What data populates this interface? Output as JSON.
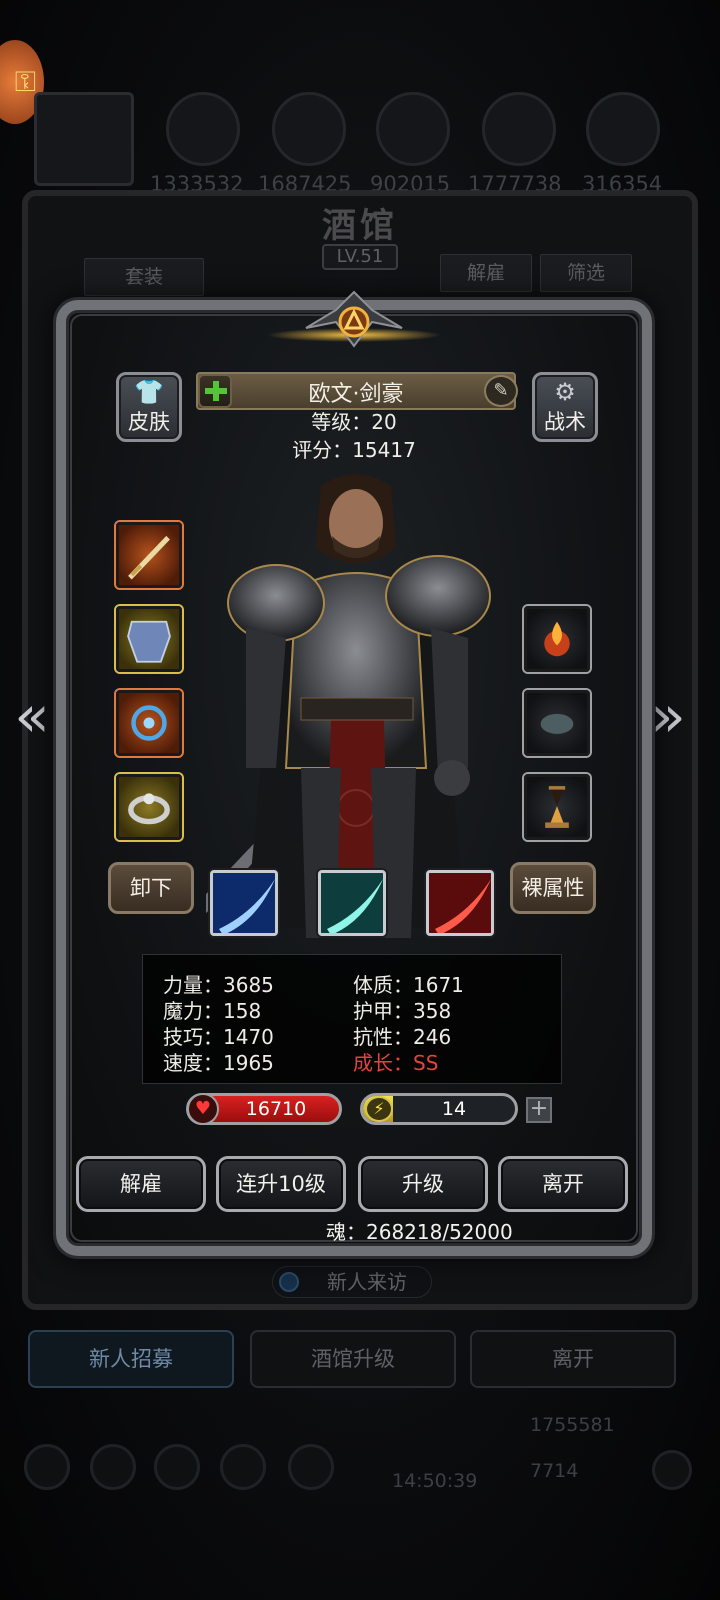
{
  "background": {
    "title": "酒馆",
    "level": "LV.51",
    "top_numbers": [
      "1333532",
      "1687425",
      "902015",
      "1777738",
      "316354"
    ],
    "buttons": {
      "set": "套装",
      "dismiss": "解雇",
      "filter": "筛选"
    },
    "partial_value": "268218",
    "visitor": "新人来访",
    "tabs": [
      "新人招募",
      "酒馆升级",
      "离开"
    ],
    "gold": "1755581",
    "gems": "7714",
    "clock": "14:50:39"
  },
  "hero": {
    "name": "欧文·剑豪",
    "level_line": "等级：20",
    "score_line": "评分：15417",
    "skin_label": "皮肤",
    "tactics_label": "战术",
    "unequip_label": "卸下",
    "base_attr_label": "裸属性",
    "stats": {
      "strength": "力量：3685",
      "constitution": "体质：1671",
      "magic": "魔力：158",
      "armor": "护甲：358",
      "skill": "技巧：1470",
      "resistance": "抗性：246",
      "speed": "速度：1965",
      "growth": "成长：SS"
    },
    "hp": "16710",
    "energy": "14",
    "energy_fill": 0.2,
    "actions": {
      "dismiss": "解雇",
      "level10": "连升10级",
      "upgrade": "升级",
      "leave": "离开"
    },
    "soul": "魂：268218/52000"
  },
  "colors": {
    "growth_red": "#e2453a",
    "hp_red": "#d92020",
    "energy_yellow": "#f3e24a",
    "name_plate": "#6b5c44"
  },
  "icons": {
    "equip_left": [
      "sword-icon",
      "breastplate-icon",
      "amulet-icon",
      "ring-icon"
    ],
    "equip_right": [
      "flame-orb-icon",
      "stone-icon",
      "hourglass-icon"
    ],
    "skills": [
      "blue-slash-icon",
      "cyan-slash-icon",
      "red-slash-icon"
    ]
  }
}
